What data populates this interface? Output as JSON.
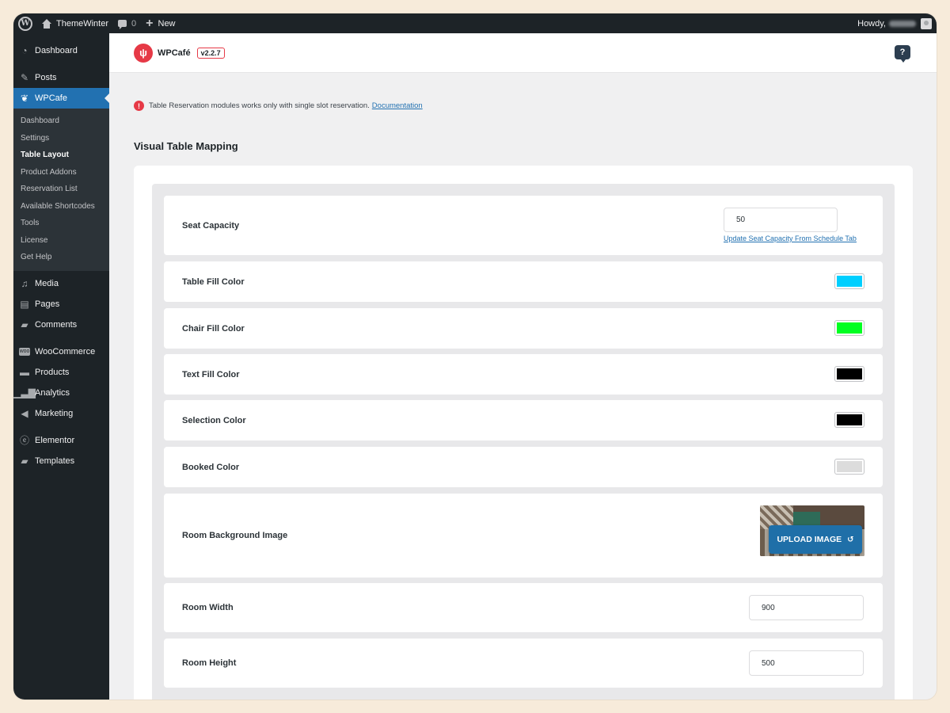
{
  "adminbar": {
    "site_name": "ThemeWinter",
    "comments_count": "0",
    "new_label": "New",
    "howdy": "Howdy,"
  },
  "sidebar": {
    "items_top": [
      {
        "label": "Dashboard",
        "icon": "dashboard-icon"
      },
      {
        "label": "Posts",
        "icon": "pin-icon"
      }
    ],
    "active_item": {
      "label": "WPCafe",
      "icon": "wpcafe-icon"
    },
    "submenu": [
      {
        "label": "Dashboard"
      },
      {
        "label": "Settings"
      },
      {
        "label": "Table Layout",
        "current": true
      },
      {
        "label": "Product Addons"
      },
      {
        "label": "Reservation List"
      },
      {
        "label": "Available Shortcodes"
      },
      {
        "label": "Tools"
      },
      {
        "label": "License"
      },
      {
        "label": "Get Help"
      }
    ],
    "items_group1": [
      {
        "label": "Media",
        "icon": "media-icon"
      },
      {
        "label": "Pages",
        "icon": "pages-icon"
      },
      {
        "label": "Comments",
        "icon": "comments-icon"
      }
    ],
    "items_group2": [
      {
        "label": "WooCommerce",
        "icon": "woocommerce-icon"
      },
      {
        "label": "Products",
        "icon": "products-icon"
      },
      {
        "label": "Analytics",
        "icon": "analytics-icon"
      },
      {
        "label": "Marketing",
        "icon": "marketing-icon"
      }
    ],
    "items_group3": [
      {
        "label": "Elementor",
        "icon": "elementor-icon"
      },
      {
        "label": "Templates",
        "icon": "folder-icon"
      }
    ]
  },
  "header": {
    "brand": "WPCafé",
    "version": "v2.2.7",
    "help": "?"
  },
  "notice": {
    "text": "Table Reservation modules works only with single slot reservation.",
    "link": "Documentation"
  },
  "page_title": "Visual Table Mapping",
  "settings": {
    "seat_capacity": {
      "label": "Seat Capacity",
      "value": "50",
      "link": "Update Seat Capacity From Schedule Tab"
    },
    "table_fill": {
      "label": "Table Fill Color",
      "color": "#00cfff"
    },
    "chair_fill": {
      "label": "Chair Fill Color",
      "color": "#00ff22"
    },
    "text_fill": {
      "label": "Text Fill Color",
      "color": "#000000"
    },
    "selection": {
      "label": "Selection Color",
      "color": "#000000"
    },
    "booked": {
      "label": "Booked Color",
      "color": "#dcdcdc"
    },
    "room_bg": {
      "label": "Room Background Image",
      "button": "UPLOAD IMAGE"
    },
    "room_width": {
      "label": "Room Width",
      "value": "900"
    },
    "room_height": {
      "label": "Room Height",
      "value": "500"
    }
  },
  "colors": {
    "accent": "#2271b1",
    "brand": "#e63946",
    "admin_dark": "#1d2327"
  }
}
